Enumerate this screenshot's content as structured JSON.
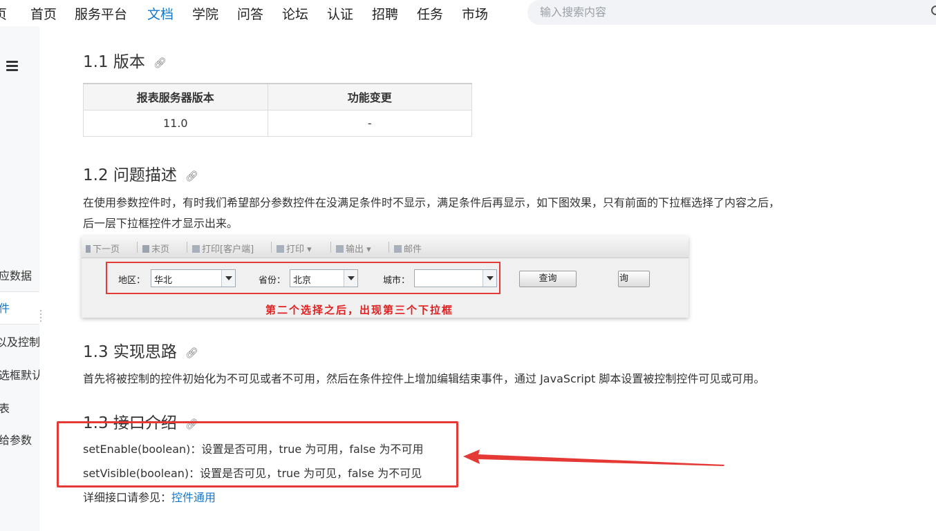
{
  "nav": {
    "partial_left": "页",
    "items": [
      "首页",
      "服务平台",
      "文档",
      "学院",
      "问答",
      "论坛",
      "认证",
      "招聘",
      "任务",
      "市场"
    ],
    "active_index": 2,
    "search_placeholder": "输入搜索内容"
  },
  "sidebar": {
    "items": [
      "应数据",
      "件",
      "以及控制",
      "选框默认",
      "表",
      "给参数"
    ],
    "active_index": 1
  },
  "content": {
    "section_version": "1.1 版本",
    "version_table": {
      "headers": [
        "报表服务器版本",
        "功能变更"
      ],
      "rows": [
        [
          "11.0",
          "-"
        ]
      ]
    },
    "section_problem": "1.2 问题描述",
    "problem_line1": "在使用参数控件时，有时我们希望部分参数控件在没满足条件时不显示，满足条件后再显示，如下图效果，只有前面的下拉框选择了内容之后，",
    "problem_line2": "后一层下拉框控件才显示出来。",
    "section_idea": "1.3 实现思路",
    "idea_text": "首先将被控制的控件初始化为不可见或者不可用，然后在条件控件上增加编辑结束事件，通过 JavaScript 脚本设置被控制控件可见或可用。",
    "section_api": "1.3 接口介绍",
    "api_line1": "setEnable(boolean)：设置是否可用，true 为可用，false 为不可用",
    "api_line2": "setVisible(boolean)：设置是否可见，true 为可见，false 为不可见",
    "detail_prefix": "详细接口请参见：",
    "detail_link": "控件通用"
  },
  "screenshot": {
    "toolbar": [
      "下一页",
      "末页",
      "打印[客户端]",
      "打印",
      "输出",
      "邮件"
    ],
    "labels": {
      "region": "地区：",
      "province": "省份：",
      "city": "城市："
    },
    "values": {
      "region": "华北",
      "province": "北京",
      "city": ""
    },
    "query_button": "查询",
    "query_button_partial": "询",
    "caption": "第二个选择之后，出现第三个下拉框"
  },
  "colors": {
    "accent": "#1677c9",
    "annotation_red": "#e53935"
  }
}
